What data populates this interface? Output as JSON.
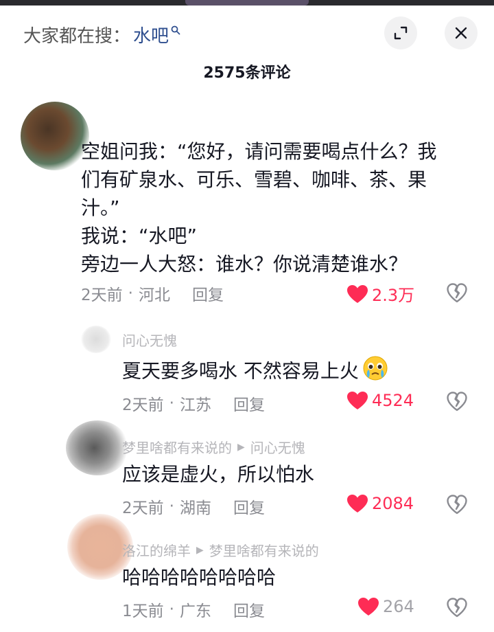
{
  "search": {
    "prefix": "大家都在搜：",
    "keyword": "水吧"
  },
  "header": {
    "comment_count": "2575条评论"
  },
  "comments": [
    {
      "lines": [
        "空姐问我：“您好，请问需要喝点什么？我",
        "们有矿泉水、可乐、雪碧、咖啡、茶、果",
        "汁。”",
        "我说：“水吧”",
        "旁边一人大怒：谁水？你说清楚谁水？"
      ],
      "time": "2天前",
      "region": "河北",
      "reply_label": "回复",
      "likes": "2.3万"
    },
    {
      "author": "问心无愧",
      "text": "夏天要多喝水 不然容易上火",
      "time": "2天前",
      "region": "江苏",
      "reply_label": "回复",
      "likes": "4524"
    },
    {
      "author": "梦里啥都有来说的",
      "reply_to": "问心无愧",
      "text": "应该是虚火，所以怕水",
      "time": "2天前",
      "region": "湖南",
      "reply_label": "回复",
      "likes": "2084"
    },
    {
      "author": "洛江的绵羊",
      "reply_to": "梦里啥都有来说的",
      "text": "哈哈哈哈哈哈哈哈",
      "time": "1天前",
      "region": "广东",
      "reply_label": "回复",
      "likes": "264"
    }
  ],
  "icons": {
    "search": "search-icon",
    "expand": "expand-icon",
    "close": "close-icon",
    "like": "heart-icon",
    "dislike": "broken-heart-icon",
    "reply_arrow": "play-arrow-icon",
    "emoji": "crying-face-emoji"
  },
  "colors": {
    "accent": "#fe2c55",
    "keyword": "#2f4f8f",
    "meta": "#8a8b91"
  }
}
